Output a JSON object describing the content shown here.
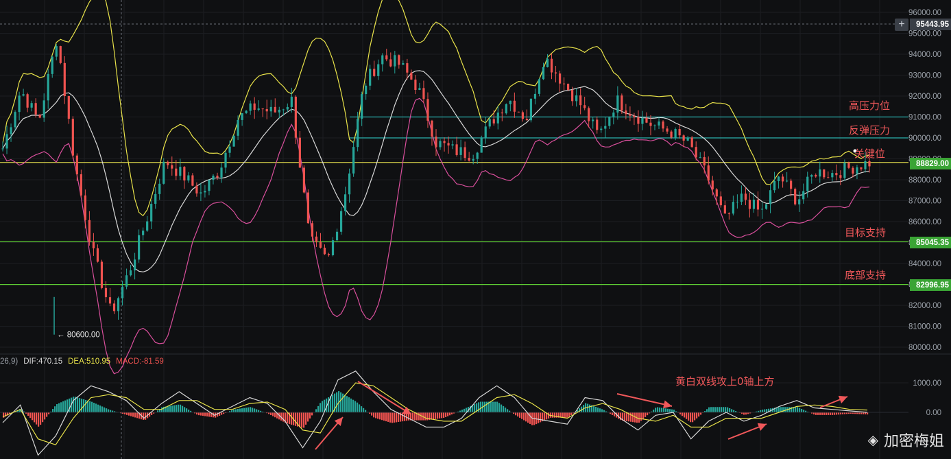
{
  "chart_data": {
    "type": "candlestick",
    "price_axis": {
      "ticks": [
        "96000.00",
        "95000.00",
        "94000.00",
        "93000.00",
        "92000.00",
        "91000.00",
        "90000.00",
        "89000.00",
        "88000.00",
        "87000.00",
        "86000.00",
        "85000.00",
        "84000.00",
        "83000.00",
        "82000.00",
        "81000.00",
        "80000.00"
      ],
      "tick_values": [
        96000,
        95000,
        94000,
        93000,
        92000,
        91000,
        90000,
        89000,
        88000,
        87000,
        86000,
        85000,
        84000,
        83000,
        82000,
        81000,
        80000
      ],
      "ylim": [
        79600,
        96500
      ]
    },
    "price_tags": [
      {
        "label": "95443.95",
        "value": 95443.95,
        "color": "#3a3f47"
      },
      {
        "label": "88829.00",
        "value": 88829.0,
        "color": "#3aa435"
      },
      {
        "label": "85045.35",
        "value": 85045.35,
        "color": "#3aa435"
      },
      {
        "label": "82996.95",
        "value": 82996.95,
        "color": "#3aa435"
      }
    ],
    "levels": [
      {
        "value": 91000,
        "color": "#2bb4b0",
        "label": "高压力位"
      },
      {
        "value": 90000,
        "color": "#2bb4b0",
        "label": "反弹压力"
      },
      {
        "value": 88829,
        "color": "#d9d24a",
        "label": "关键位"
      },
      {
        "value": 85045.35,
        "color": "#5fcf34",
        "label": "目标支持"
      },
      {
        "value": 82996.95,
        "color": "#5fcf34",
        "label": "底部支持"
      }
    ],
    "low_marker": {
      "label": "80600.00",
      "value": 80600
    },
    "close_anchors": [
      89500,
      92300,
      90800,
      94800,
      88700,
      84500,
      81600,
      83600,
      86200,
      88900,
      88200,
      87300,
      88500,
      90900,
      91500,
      91200,
      91800,
      85100,
      84100,
      87500,
      92500,
      93900,
      93500,
      92400,
      89800,
      89400,
      89200,
      90700,
      91900,
      90900,
      93900,
      92700,
      91600,
      90100,
      91800,
      91100,
      90600,
      90300,
      89700,
      88200,
      86100,
      87200,
      86400,
      88200,
      87000,
      88400,
      88300,
      88600,
      88829
    ],
    "macd": {
      "label": "26,9)",
      "dif_label": "DIF:470.15",
      "dea_label": "DEA:510.95",
      "macd_label": "MACD:-81.59",
      "ticks": [
        "1000.00",
        "0.00"
      ],
      "dif": [
        -350,
        250,
        -1450,
        -800,
        400,
        900,
        700,
        400,
        -200,
        300,
        700,
        300,
        -100,
        200,
        500,
        300,
        -300,
        -1200,
        -300,
        1100,
        1400,
        700,
        100,
        -200,
        -500,
        -500,
        -200,
        500,
        900,
        500,
        -200,
        -300,
        -400,
        500,
        400,
        -200,
        -600,
        -100,
        0,
        -900,
        -300,
        0,
        -300,
        -100,
        200,
        400,
        150,
        100,
        50,
        0
      ],
      "dea": [
        -150,
        100,
        -900,
        -1100,
        -200,
        500,
        600,
        500,
        100,
        100,
        400,
        400,
        100,
        100,
        300,
        350,
        100,
        -600,
        -700,
        300,
        1000,
        900,
        500,
        100,
        -200,
        -300,
        -300,
        100,
        500,
        600,
        300,
        -100,
        -200,
        150,
        300,
        100,
        -200,
        -300,
        -100,
        -500,
        -500,
        -200,
        -200,
        -200,
        0,
        200,
        250,
        200,
        100,
        80
      ]
    }
  },
  "annotations": {
    "high_resist": "高压力位",
    "rebound_resist": "反弹压力",
    "key_level": "关键位",
    "target_support": "目标支持",
    "bottom_support": "底部支持",
    "macd_note": "黄白双线攻上0轴上方"
  },
  "watermark": "加密梅姐",
  "colors": {
    "up": "#26a69a",
    "down": "#ef5350",
    "boll_upper": "#e8e24a",
    "boll_mid": "#d8d8d8",
    "boll_lower": "#d94f9c"
  }
}
